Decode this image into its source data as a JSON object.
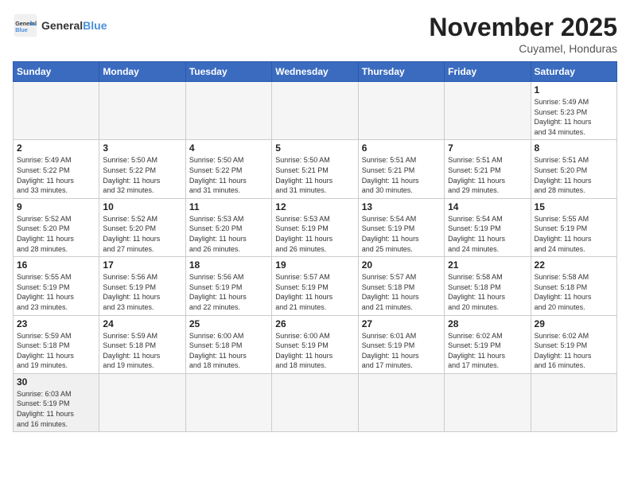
{
  "header": {
    "logo_general": "General",
    "logo_blue": "Blue",
    "month_title": "November 2025",
    "location": "Cuyamel, Honduras"
  },
  "weekdays": [
    "Sunday",
    "Monday",
    "Tuesday",
    "Wednesday",
    "Thursday",
    "Friday",
    "Saturday"
  ],
  "weeks": [
    [
      {
        "day": null,
        "empty": true
      },
      {
        "day": null,
        "empty": true
      },
      {
        "day": null,
        "empty": true
      },
      {
        "day": null,
        "empty": true
      },
      {
        "day": null,
        "empty": true
      },
      {
        "day": null,
        "empty": true
      },
      {
        "day": "1",
        "sunrise": "Sunrise: 5:49 AM",
        "sunset": "Sunset: 5:23 PM",
        "daylight": "Daylight: 11 hours and 34 minutes."
      }
    ],
    [
      {
        "day": "2",
        "sunrise": "Sunrise: 5:49 AM",
        "sunset": "Sunset: 5:22 PM",
        "daylight": "Daylight: 11 hours and 33 minutes."
      },
      {
        "day": "3",
        "sunrise": "Sunrise: 5:50 AM",
        "sunset": "Sunset: 5:22 PM",
        "daylight": "Daylight: 11 hours and 32 minutes."
      },
      {
        "day": "4",
        "sunrise": "Sunrise: 5:50 AM",
        "sunset": "Sunset: 5:22 PM",
        "daylight": "Daylight: 11 hours and 31 minutes."
      },
      {
        "day": "5",
        "sunrise": "Sunrise: 5:50 AM",
        "sunset": "Sunset: 5:21 PM",
        "daylight": "Daylight: 11 hours and 31 minutes."
      },
      {
        "day": "6",
        "sunrise": "Sunrise: 5:51 AM",
        "sunset": "Sunset: 5:21 PM",
        "daylight": "Daylight: 11 hours and 30 minutes."
      },
      {
        "day": "7",
        "sunrise": "Sunrise: 5:51 AM",
        "sunset": "Sunset: 5:21 PM",
        "daylight": "Daylight: 11 hours and 29 minutes."
      },
      {
        "day": "8",
        "sunrise": "Sunrise: 5:51 AM",
        "sunset": "Sunset: 5:20 PM",
        "daylight": "Daylight: 11 hours and 28 minutes."
      }
    ],
    [
      {
        "day": "9",
        "sunrise": "Sunrise: 5:52 AM",
        "sunset": "Sunset: 5:20 PM",
        "daylight": "Daylight: 11 hours and 28 minutes."
      },
      {
        "day": "10",
        "sunrise": "Sunrise: 5:52 AM",
        "sunset": "Sunset: 5:20 PM",
        "daylight": "Daylight: 11 hours and 27 minutes."
      },
      {
        "day": "11",
        "sunrise": "Sunrise: 5:53 AM",
        "sunset": "Sunset: 5:20 PM",
        "daylight": "Daylight: 11 hours and 26 minutes."
      },
      {
        "day": "12",
        "sunrise": "Sunrise: 5:53 AM",
        "sunset": "Sunset: 5:19 PM",
        "daylight": "Daylight: 11 hours and 26 minutes."
      },
      {
        "day": "13",
        "sunrise": "Sunrise: 5:54 AM",
        "sunset": "Sunset: 5:19 PM",
        "daylight": "Daylight: 11 hours and 25 minutes."
      },
      {
        "day": "14",
        "sunrise": "Sunrise: 5:54 AM",
        "sunset": "Sunset: 5:19 PM",
        "daylight": "Daylight: 11 hours and 24 minutes."
      },
      {
        "day": "15",
        "sunrise": "Sunrise: 5:55 AM",
        "sunset": "Sunset: 5:19 PM",
        "daylight": "Daylight: 11 hours and 24 minutes."
      }
    ],
    [
      {
        "day": "16",
        "sunrise": "Sunrise: 5:55 AM",
        "sunset": "Sunset: 5:19 PM",
        "daylight": "Daylight: 11 hours and 23 minutes."
      },
      {
        "day": "17",
        "sunrise": "Sunrise: 5:56 AM",
        "sunset": "Sunset: 5:19 PM",
        "daylight": "Daylight: 11 hours and 23 minutes."
      },
      {
        "day": "18",
        "sunrise": "Sunrise: 5:56 AM",
        "sunset": "Sunset: 5:19 PM",
        "daylight": "Daylight: 11 hours and 22 minutes."
      },
      {
        "day": "19",
        "sunrise": "Sunrise: 5:57 AM",
        "sunset": "Sunset: 5:19 PM",
        "daylight": "Daylight: 11 hours and 21 minutes."
      },
      {
        "day": "20",
        "sunrise": "Sunrise: 5:57 AM",
        "sunset": "Sunset: 5:18 PM",
        "daylight": "Daylight: 11 hours and 21 minutes."
      },
      {
        "day": "21",
        "sunrise": "Sunrise: 5:58 AM",
        "sunset": "Sunset: 5:18 PM",
        "daylight": "Daylight: 11 hours and 20 minutes."
      },
      {
        "day": "22",
        "sunrise": "Sunrise: 5:58 AM",
        "sunset": "Sunset: 5:18 PM",
        "daylight": "Daylight: 11 hours and 20 minutes."
      }
    ],
    [
      {
        "day": "23",
        "sunrise": "Sunrise: 5:59 AM",
        "sunset": "Sunset: 5:18 PM",
        "daylight": "Daylight: 11 hours and 19 minutes."
      },
      {
        "day": "24",
        "sunrise": "Sunrise: 5:59 AM",
        "sunset": "Sunset: 5:18 PM",
        "daylight": "Daylight: 11 hours and 19 minutes."
      },
      {
        "day": "25",
        "sunrise": "Sunrise: 6:00 AM",
        "sunset": "Sunset: 5:18 PM",
        "daylight": "Daylight: 11 hours and 18 minutes."
      },
      {
        "day": "26",
        "sunrise": "Sunrise: 6:00 AM",
        "sunset": "Sunset: 5:19 PM",
        "daylight": "Daylight: 11 hours and 18 minutes."
      },
      {
        "day": "27",
        "sunrise": "Sunrise: 6:01 AM",
        "sunset": "Sunset: 5:19 PM",
        "daylight": "Daylight: 11 hours and 17 minutes."
      },
      {
        "day": "28",
        "sunrise": "Sunrise: 6:02 AM",
        "sunset": "Sunset: 5:19 PM",
        "daylight": "Daylight: 11 hours and 17 minutes."
      },
      {
        "day": "29",
        "sunrise": "Sunrise: 6:02 AM",
        "sunset": "Sunset: 5:19 PM",
        "daylight": "Daylight: 11 hours and 16 minutes."
      }
    ],
    [
      {
        "day": "30",
        "sunrise": "Sunrise: 6:03 AM",
        "sunset": "Sunset: 5:19 PM",
        "daylight": "Daylight: 11 hours and 16 minutes.",
        "lastrow": true
      },
      {
        "day": null,
        "empty": true,
        "lastrow": true
      },
      {
        "day": null,
        "empty": true,
        "lastrow": true
      },
      {
        "day": null,
        "empty": true,
        "lastrow": true
      },
      {
        "day": null,
        "empty": true,
        "lastrow": true
      },
      {
        "day": null,
        "empty": true,
        "lastrow": true
      },
      {
        "day": null,
        "empty": true,
        "lastrow": true
      }
    ]
  ]
}
